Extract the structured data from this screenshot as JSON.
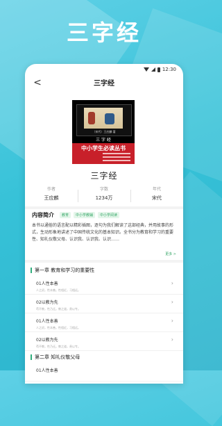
{
  "hero_title": "三字经",
  "status": {
    "time": "12:30"
  },
  "nav": {
    "back": "<",
    "title": "三字经"
  },
  "cover": {
    "subtitle": "（宋代）王应麟 著",
    "name": "三 字 经",
    "series": "中小学生必读丛书"
  },
  "book": {
    "title": "三字经",
    "meta": [
      {
        "label": "作者",
        "value": "王应麟"
      },
      {
        "label": "字数",
        "value": "1234万"
      },
      {
        "label": "年代",
        "value": "宋代"
      }
    ]
  },
  "intro": {
    "title": "内容简介",
    "tags": [
      "教育",
      "中小学教辅",
      "中小学阅读"
    ],
    "text": "本书以通俗的语言配以精彩插图，逐句为我们解读了这部经典，并用故事的形式，生动形象地讲述了中国传统文化的基本知识。全书分为教育和学习的重要性、知礼仪敬父母、认识我、认识我、认识……",
    "more": "更多 >"
  },
  "chapters": [
    {
      "title": "第一章 教育和学习的重要性",
      "items": [
        {
          "title": "01人性本善",
          "sub": "人之初，性本善。性相近，习相远。"
        },
        {
          "title": "02以教为先",
          "sub": "苟不教，性乃迁。教之道，贵以专。"
        },
        {
          "title": "01人性本善",
          "sub": "人之初，性本善。性相近，习相远。"
        },
        {
          "title": "02以教为先",
          "sub": "苟不教，性乃迁。教之道，贵以专。"
        }
      ]
    },
    {
      "title": "第二章 知礼仪敬父母",
      "items": [
        {
          "title": "01人性本善",
          "sub": ""
        }
      ]
    }
  ]
}
